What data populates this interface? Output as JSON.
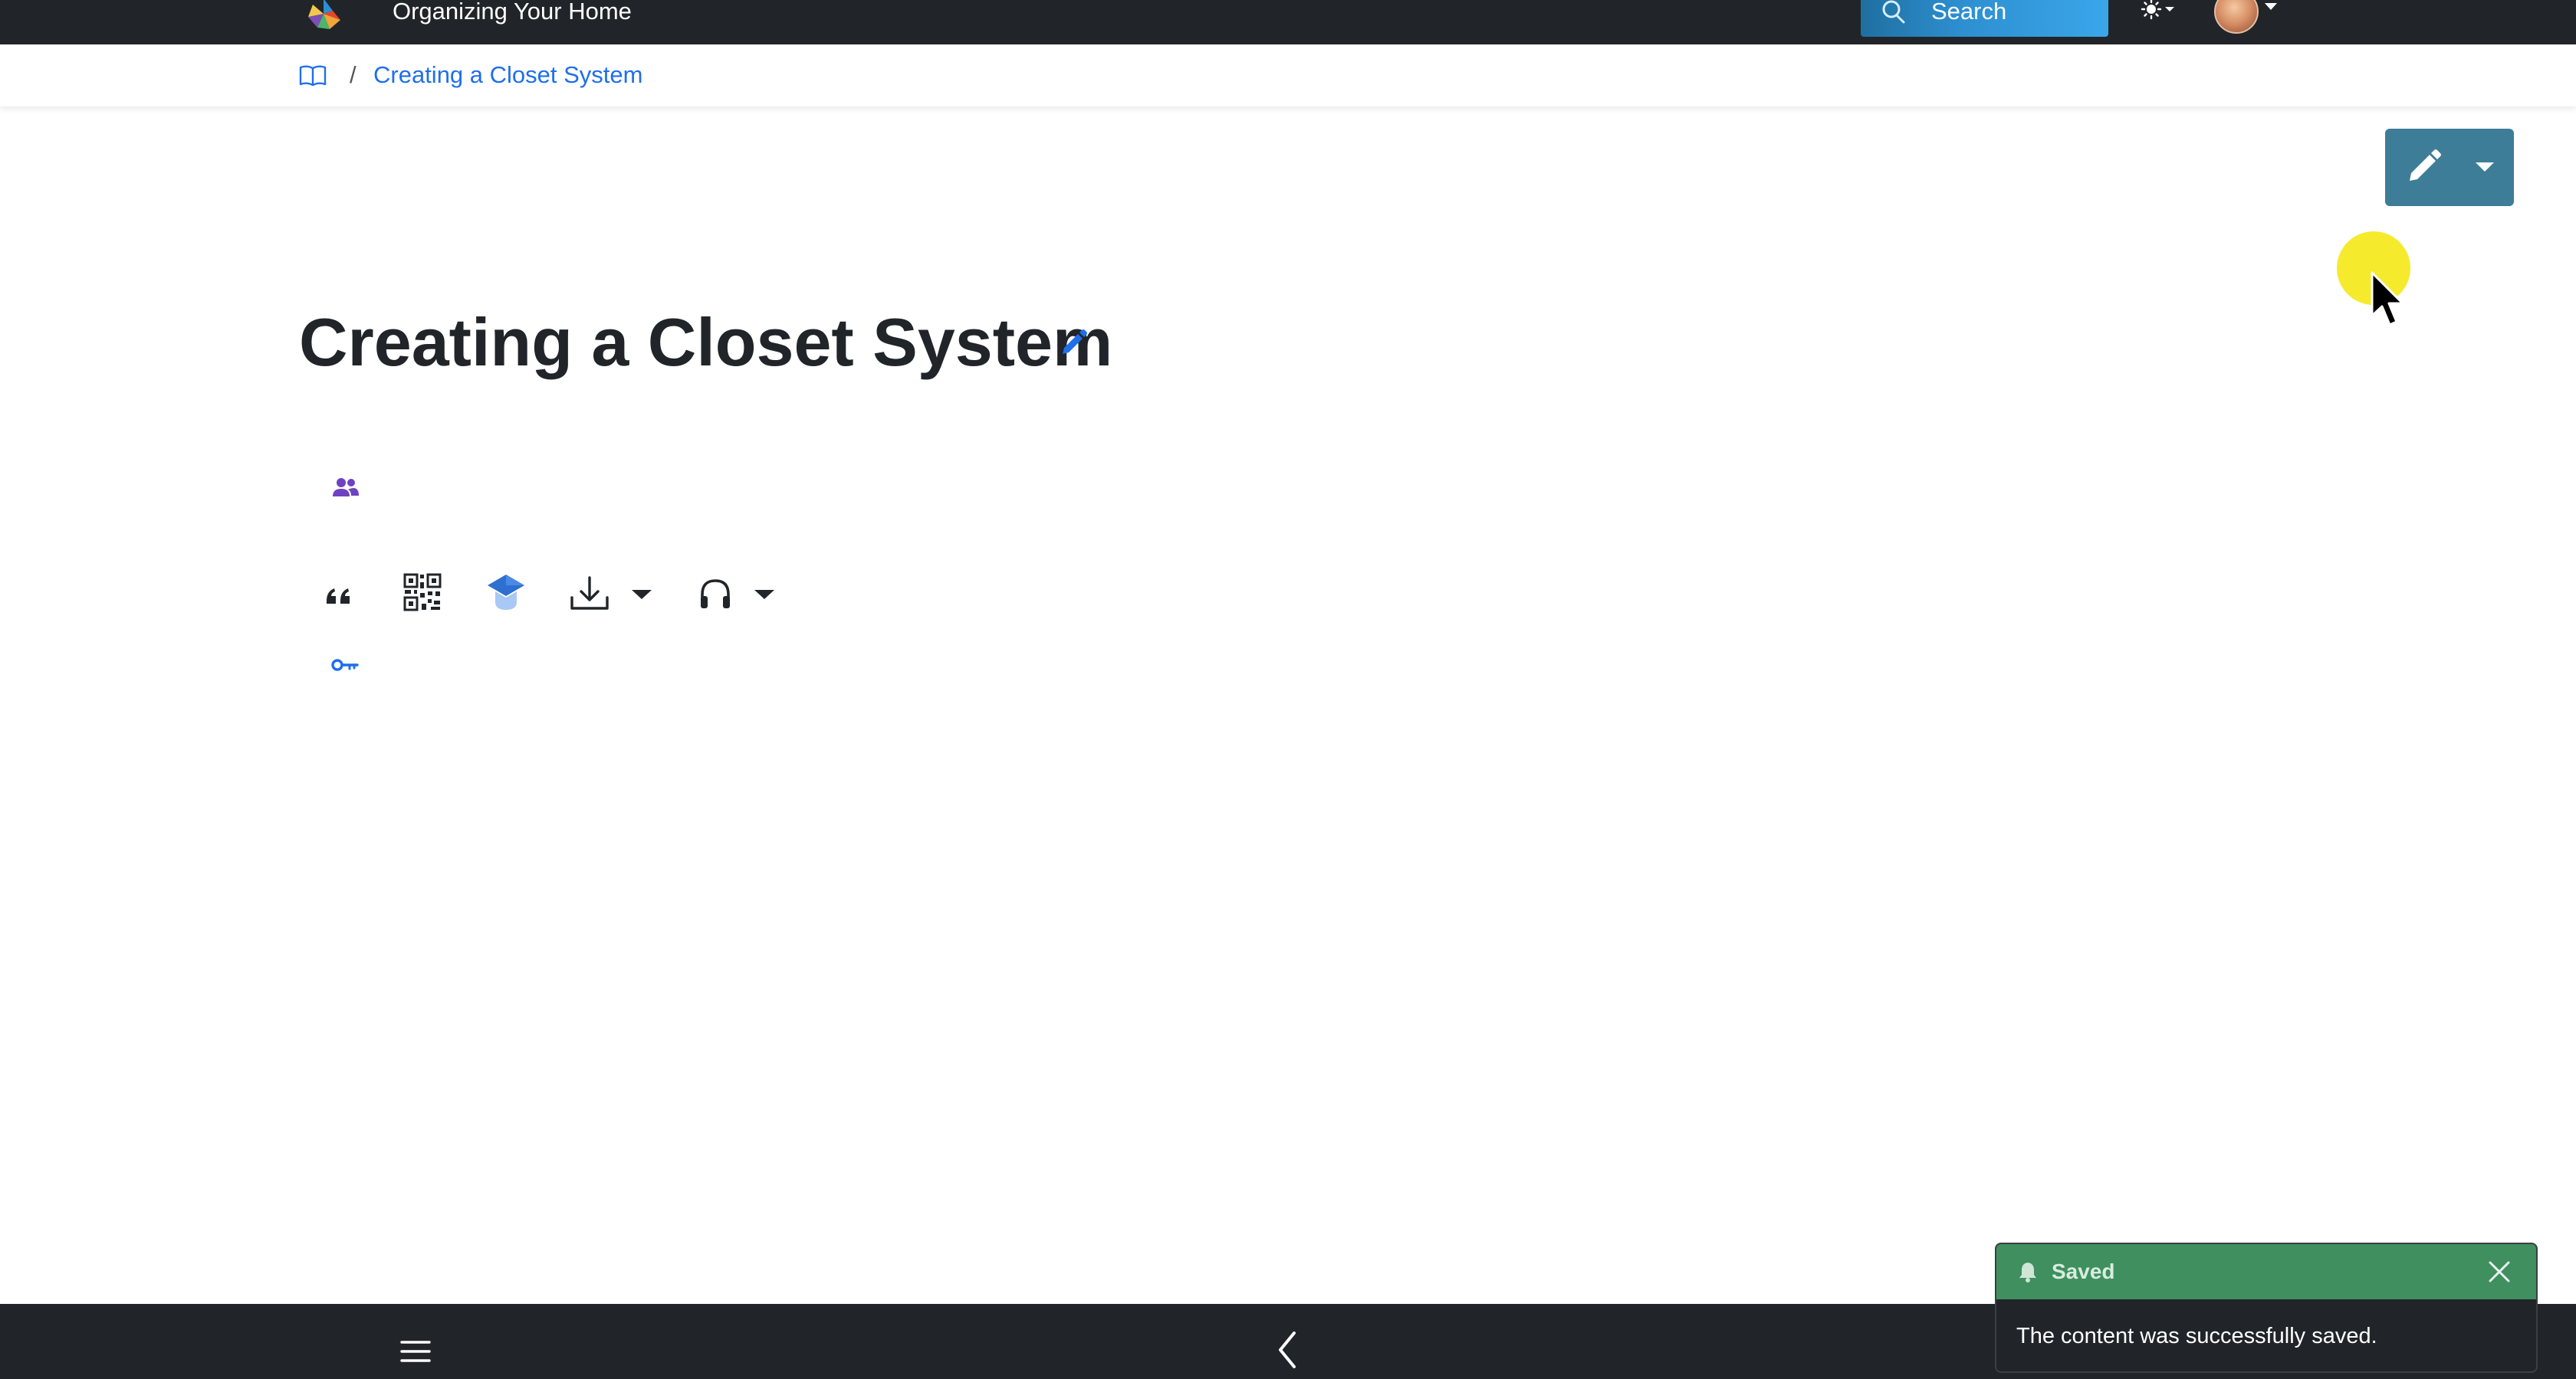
{
  "app": {
    "title": "Organizing Your Home"
  },
  "search": {
    "label": "Search"
  },
  "breadcrumb": {
    "separator": "/",
    "current": "Creating a Closet System"
  },
  "page": {
    "title": "Creating a Closet System"
  },
  "toast": {
    "title": "Saved",
    "message": "The content was successfully saved."
  },
  "colors": {
    "navbar": "#212529",
    "accent_link": "#1f6feb",
    "edit_button": "#3e7d97",
    "toast_header": "#3f8f5f",
    "cursor_highlight": "#f6ea2c"
  },
  "icons": {
    "topbar": [
      "logo-icon",
      "search-icon",
      "sun-icon",
      "avatar",
      "chevron-down-icon"
    ],
    "breadcrumb": [
      "book-icon"
    ],
    "content": [
      "pencil-icon",
      "users-icon",
      "quote-icon",
      "qr-code-icon",
      "graduation-cap-icon",
      "download-icon",
      "headphones-icon",
      "key-icon"
    ],
    "bottombar": [
      "menu-icon",
      "chevron-left-icon"
    ],
    "toast": [
      "bell-icon",
      "close-icon"
    ]
  }
}
